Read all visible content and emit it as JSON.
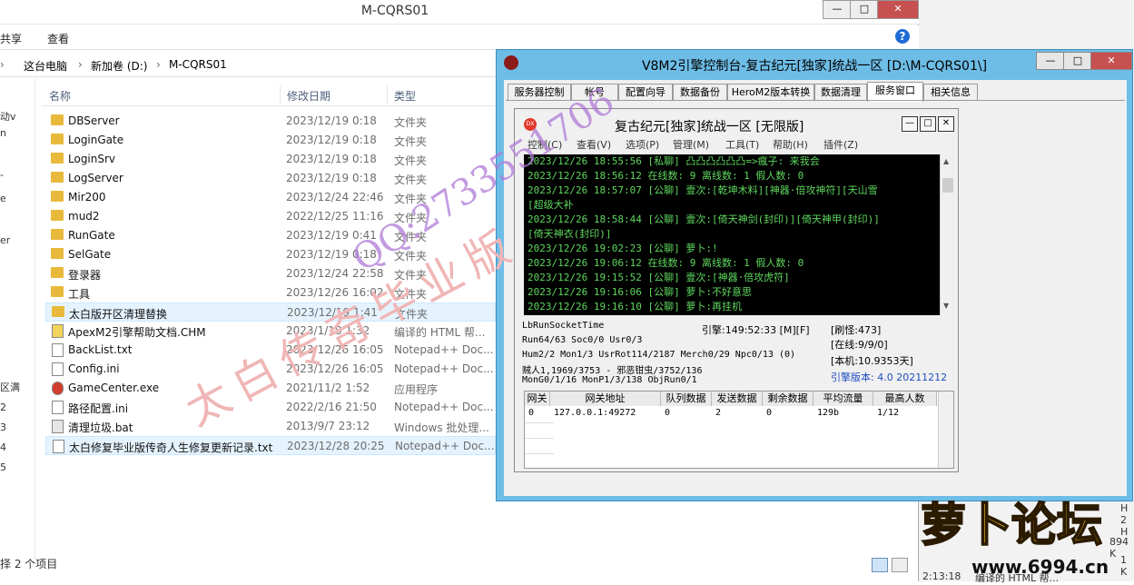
{
  "explorer": {
    "title": "M-CQRS01",
    "controls": {
      "minimize": "—",
      "maximize": "□",
      "close": "✕"
    },
    "ribbon": {
      "share": "共享",
      "view": "查看",
      "help": "?"
    },
    "address": {
      "pc": "这台电脑",
      "drive": "新加卷 (D:)",
      "folder": "M-CQRS01",
      "sep": "›"
    },
    "columns": {
      "name": "名称",
      "date": "修改日期",
      "type": "类型"
    },
    "left_pane": [
      "动v",
      "n",
      "-",
      "e",
      "er",
      "区满",
      "2",
      "3",
      "4",
      "5"
    ],
    "files": [
      {
        "name": "DBServer",
        "date": "2023/12/19 0:18",
        "type": "文件夹",
        "icon": "folder"
      },
      {
        "name": "LoginGate",
        "date": "2023/12/19 0:18",
        "type": "文件夹",
        "icon": "folder"
      },
      {
        "name": "LoginSrv",
        "date": "2023/12/19 0:18",
        "type": "文件夹",
        "icon": "folder"
      },
      {
        "name": "LogServer",
        "date": "2023/12/19 0:18",
        "type": "文件夹",
        "icon": "folder"
      },
      {
        "name": "Mir200",
        "date": "2023/12/24 22:46",
        "type": "文件夹",
        "icon": "folder"
      },
      {
        "name": "mud2",
        "date": "2022/12/25 11:16",
        "type": "文件夹",
        "icon": "folder"
      },
      {
        "name": "RunGate",
        "date": "2023/12/19 0:41",
        "type": "文件夹",
        "icon": "folder"
      },
      {
        "name": "SelGate",
        "date": "2023/12/19 0:18",
        "type": "文件夹",
        "icon": "folder"
      },
      {
        "name": "登录器",
        "date": "2023/12/24 22:58",
        "type": "文件夹",
        "icon": "folder"
      },
      {
        "name": "工具",
        "date": "2023/12/26 16:02",
        "type": "文件夹",
        "icon": "folder"
      },
      {
        "name": "太白版开区清理替换",
        "date": "2023/12/19 1:41",
        "type": "文件夹",
        "icon": "folder",
        "selected": true
      },
      {
        "name": "ApexM2引擎帮助文档.CHM",
        "date": "2023/1/18 1:32",
        "type": "编译的 HTML 帮...",
        "icon": "help-file"
      },
      {
        "name": "BackList.txt",
        "date": "2023/12/26 16:05",
        "type": "Notepad++ Doc...",
        "icon": "text-file"
      },
      {
        "name": "Config.ini",
        "date": "2023/12/26 16:05",
        "type": "Notepad++ Doc...",
        "icon": "ini-file"
      },
      {
        "name": "GameCenter.exe",
        "date": "2021/11/2 1:52",
        "type": "应用程序",
        "icon": "exe-file"
      },
      {
        "name": "路径配置.ini",
        "date": "2022/2/16 21:50",
        "type": "Notepad++ Doc...",
        "icon": "ini-file"
      },
      {
        "name": "清理垃圾.bat",
        "date": "2013/9/7 23:12",
        "type": "Windows 批处理...",
        "icon": "bat-file"
      },
      {
        "name": "太白修复毕业版传奇人生修复更新记录.txt",
        "date": "2023/12/28 20:25",
        "type": "Notepad++ Doc...",
        "icon": "text-file",
        "selected": true
      }
    ],
    "status": "择 2 个项目"
  },
  "console": {
    "title": "V8M2引擎控制台-复古纪元[独家]统战一区 [D:\\M-CQRS01\\]",
    "controls": {
      "minimize": "—",
      "maximize": "□",
      "close": "✕"
    },
    "tabs": [
      "服务器控制",
      "帐号",
      "配置向导",
      "数据备份",
      "HeroM2版本转换",
      "数据清理",
      "服务窗口",
      "相关信息"
    ],
    "active_tab": "服务窗口",
    "inner": {
      "title": "复古纪元[独家]统战一区 [无限版]",
      "logo_text": "DX",
      "controls": {
        "minimize": "—",
        "maximize": "□",
        "close": "✕"
      },
      "menu": [
        "控制(C)",
        "查看(V)",
        "选项(P)",
        "管理(M)",
        "工具(T)",
        "帮助(H)",
        "插件(Z)"
      ],
      "log": [
        "2023/12/26 18:55:56 [私聊] 凸凸凸凸凸凸=>瘋子: 来我会",
        "2023/12/26 18:56:12 在线数: 9 离线数: 1 假人数: 0",
        "2023/12/26 18:57:07 [公聊] 壹次:[乾坤木料][神器·倍攻神符][天山雪",
        "[超级大补",
        "2023/12/26 18:58:44 [公聊] 壹次:[倚天神剑(封印)][倚天神甲(封印)]",
        "[倚天神衣(封印)]",
        "2023/12/26 19:02:23 [公聊] 萝卜:!",
        "2023/12/26 19:06:12 在线数: 9 离线数: 1 假人数: 0",
        "2023/12/26 19:15:52 [公聊] 壹次:[神器·倍攻虎符]",
        "2023/12/26 19:16:06 [公聊] 萝卜:不好意思",
        "2023/12/26 19:16:10 [公聊] 萝卜:再挂机"
      ],
      "stats": {
        "line1": "LbRunSocketTime",
        "engine_time": "引擎:149:52:33 [M][F]",
        "refresh": "[刷怪:473]",
        "line2": "Run64/63 Soc0/0 Usr0/3",
        "online": "[在线:9/9/0]",
        "line3": "Hum2/2 Mon1/3 UsrRot114/2187 Merch0/29 Npc0/13 (0)",
        "local": "[本机:10.9353天]",
        "line4": "贼人1,1969/3753 - 邪恶钳虫/3752/136",
        "version": "引擎版本: 4.0 20211212",
        "line5": "MonG0/1/16 MonP1/3/138 ObjRun0/1"
      },
      "grid": {
        "headers": [
          "网关",
          "网关地址",
          "队列数据",
          "发送数据",
          "剩余数据",
          "平均流量",
          "最高人数"
        ],
        "rows": [
          [
            "0",
            "127.0.0.1:49272",
            "0",
            "2",
            "0",
            "129b",
            "1/12"
          ]
        ]
      }
    }
  },
  "watermarks": {
    "diagonal": "太白传奇毕业版",
    "qq": "QQ:2733551706",
    "forum_logo": "萝卜论坛",
    "forum_url": "www.6994.cn"
  },
  "background_partial": [
    "2 H",
    "2 H",
    "894 K",
    "1 K",
    "2:13:18",
    "编译的 HTML 帮..."
  ],
  "colors": {
    "console_frame": "#6ebde7",
    "log_bg": "#000000",
    "log_text": "#5fd75f",
    "version_text": "#1f4ec0",
    "watermark_red": "#e8a0a0",
    "watermark_purple": "#b07ad8"
  }
}
